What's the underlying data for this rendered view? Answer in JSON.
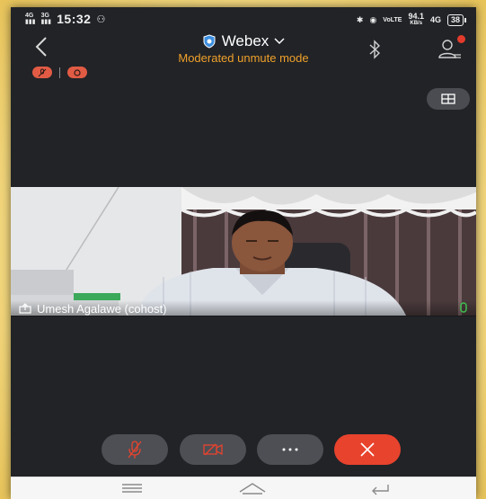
{
  "status_bar": {
    "network_left": "4G",
    "network_right": "3G",
    "time": "15:32",
    "speed_value": "94.1",
    "speed_unit": "KB/s",
    "lte_label": "4G",
    "battery": "38"
  },
  "header": {
    "app_title": "Webex",
    "mode_label": "Moderated unmute mode"
  },
  "participant": {
    "name": "Umesh Agalawe (cohost)"
  },
  "colors": {
    "accent_orange": "#f0a02a",
    "end_call_red": "#e8432d",
    "indicator_red": "#e15b44",
    "mic_green": "#3fbf4f",
    "shield_blue": "#3d8fe0"
  },
  "icons": [
    "back-icon",
    "shield-icon",
    "chevron-down-icon",
    "bluetooth-icon",
    "participants-icon",
    "layout-icon",
    "muted-mic-icon",
    "video-off-icon",
    "more-icon",
    "close-icon",
    "share-icon",
    "mic-icon",
    "menu-icon",
    "home-icon",
    "return-icon"
  ]
}
